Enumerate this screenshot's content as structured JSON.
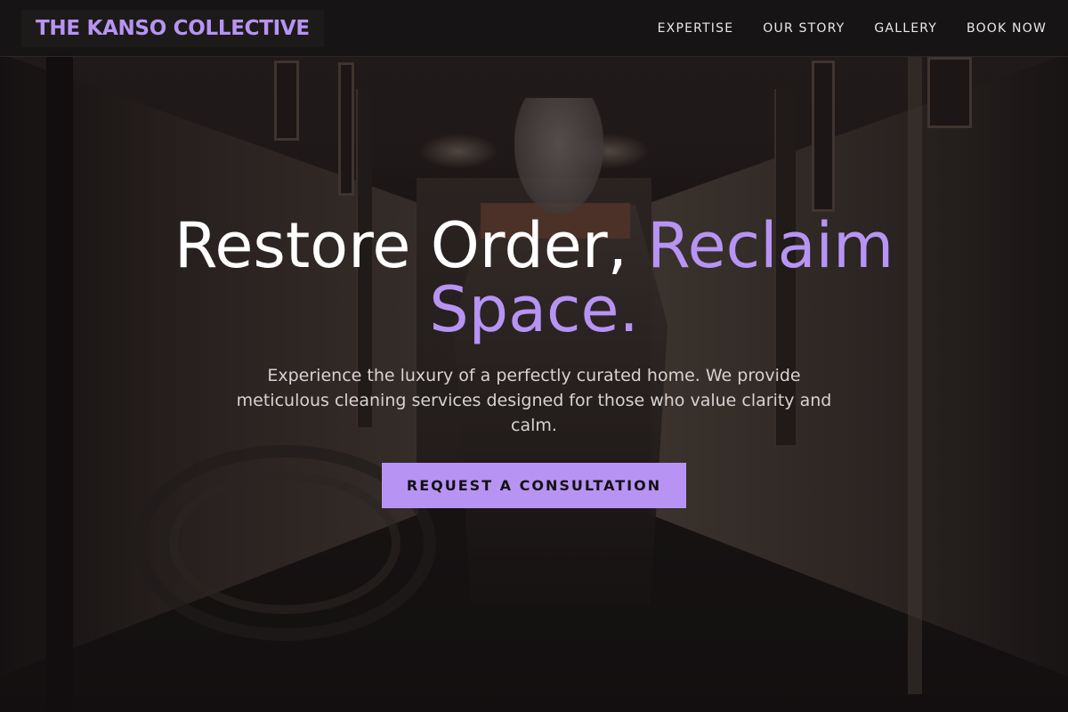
{
  "header": {
    "logo": "THE KANSO COLLECTIVE",
    "nav": [
      {
        "label": "EXPERTISE"
      },
      {
        "label": "OUR STORY"
      },
      {
        "label": "GALLERY"
      },
      {
        "label": "BOOK NOW"
      }
    ]
  },
  "hero": {
    "headline_part1": "Restore Order, ",
    "headline_accent": "Reclaim Space.",
    "subtext": "Experience the luxury of a perfectly curated home. We provide meticulous cleaning services designed for those who value clarity and calm.",
    "cta_label": "REQUEST A CONSULTATION"
  },
  "colors": {
    "accent": "#b794f4",
    "header_bg": "#161313",
    "text": "#ffffff"
  }
}
